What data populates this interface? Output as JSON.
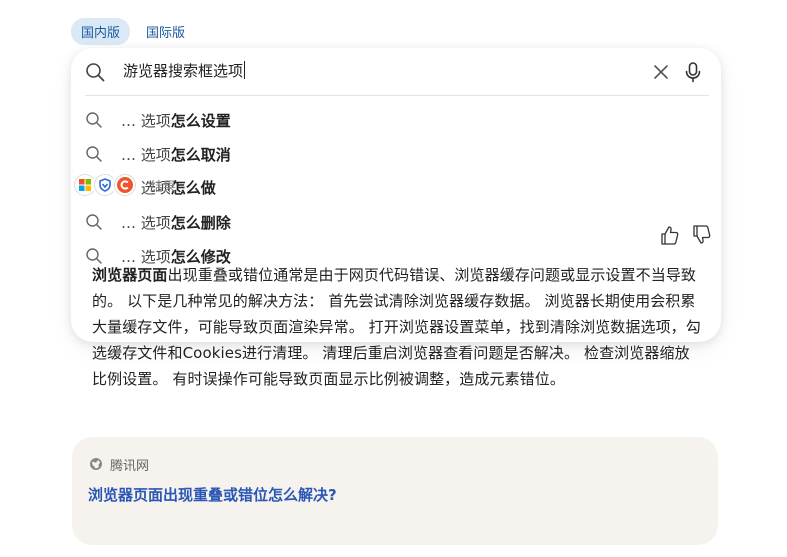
{
  "region_tabs": [
    {
      "label": "国内版",
      "active": true
    },
    {
      "label": "国际版",
      "active": false
    }
  ],
  "search": {
    "value": "游览器搜索框选项"
  },
  "suggestions": [
    {
      "prefix": "… 选项",
      "bold": "怎么设置"
    },
    {
      "prefix": "… 选项",
      "bold": "怎么取消"
    },
    {
      "prefix": "… 选项",
      "bold": "怎么做"
    },
    {
      "prefix": "… 选项",
      "bold": "怎么删除"
    },
    {
      "prefix": "… 选项",
      "bold": "怎么修改"
    }
  ],
  "partial_results_label": "结果",
  "answer": {
    "lead": "浏览器页面",
    "body": "出现重叠或错位通常是由于网页代码错误、浏览器缓存问题或显示设置不当导致的。 以下是几种常见的解决方法： 首先尝试清除浏览器缓存数据。 浏览器长期使用会积累大量缓存文件，可能导致页面渲染异常。 打开浏览器设置菜单，找到清除浏览数据选项，勾选缓存文件和Cookies进行清理。 清理后重启浏览器查看问题是否解决。 检查浏览器缩放比例设置。 有时误操作可能导致页面显示比例被调整，造成元素错位。"
  },
  "source": {
    "name": "腾讯网",
    "title": "浏览器页面出现重叠或错位怎么解决?"
  },
  "colors": {
    "tab_active_bg": "#dbe9f7",
    "link": "#2b57b4",
    "source_card_bg": "#f6f3ef"
  }
}
